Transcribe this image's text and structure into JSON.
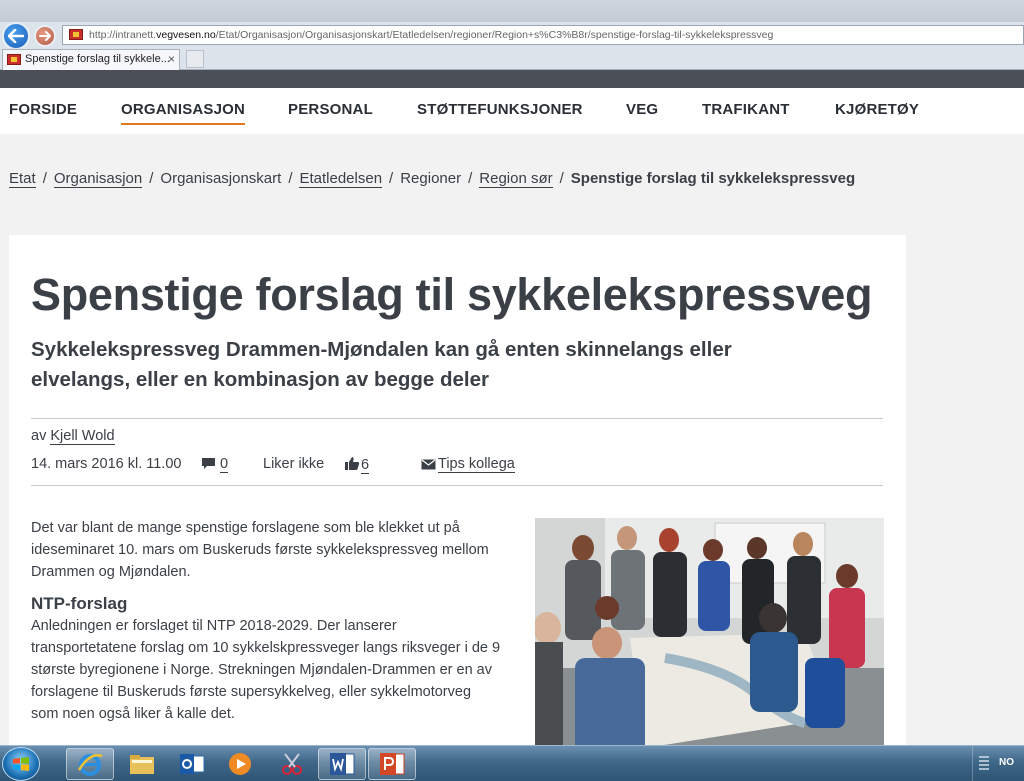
{
  "browser": {
    "url_prefix": "http://intranett.",
    "url_domain": "vegvesen.no",
    "url_path": "/Etat/Organisasjon/Organisasjonskart/Etatledelsen/regioner/Region+s%C3%B8r/spenstige-forslag-til-sykkelekspressveg",
    "tab_title": "Spenstige forslag til sykkele...",
    "tab_close": "×"
  },
  "nav": {
    "items": [
      {
        "label": "FORSIDE",
        "active": false
      },
      {
        "label": "ORGANISASJON",
        "active": true
      },
      {
        "label": "PERSONAL",
        "active": false
      },
      {
        "label": "STØTTEFUNKSJONER",
        "active": false
      },
      {
        "label": "VEG",
        "active": false
      },
      {
        "label": "TRAFIKANT",
        "active": false
      },
      {
        "label": "KJØRETØY",
        "active": false
      }
    ],
    "accent_color": "#e07a1f"
  },
  "breadcrumb": {
    "separator": "/",
    "items": [
      {
        "label": "Etat",
        "link": true
      },
      {
        "label": "Organisasjon",
        "link": true
      },
      {
        "label": "Organisasjonskart",
        "link": false
      },
      {
        "label": "Etatledelsen",
        "link": true
      },
      {
        "label": "Regioner",
        "link": false
      },
      {
        "label": "Region sør",
        "link": true
      },
      {
        "label": "Spenstige forslag til sykkelekspressveg",
        "link": false
      }
    ]
  },
  "article": {
    "title": "Spenstige forslag til sykkelekspressveg",
    "lede": "Sykkelekspressveg Drammen-Mjøndalen kan gå enten skinnelangs eller elvelangs, eller en kombinasjon av begge deler",
    "author_prefix": "av",
    "author": "Kjell Wold",
    "date": "14. mars 2016 kl. 11.00",
    "comment_count": "0",
    "unlike_label": "Liker ikke",
    "like_count": "6",
    "share_label": "Tips kollega",
    "intro": "Det var blant de mange spenstige forslagene som ble klekket ut på ideseminaret 10. mars om Buskeruds første sykkelekspressveg mellom Drammen og Mjøndalen.",
    "section_heading": "NTP-forslag",
    "section_text": "Anledningen er forslaget til NTP 2018-2029. Der lanserer transportetatene forslag om 10 sykkelskpressveger langs riksveger i de 9 største byregionene i Norge. Strekningen Mjøndalen-Drammen er en av forslagene til Buskeruds første supersykkelveg, eller sykkelmotorveg som noen også liker å kalle det."
  },
  "taskbar": {
    "apps": [
      "windows-start",
      "internet-explorer",
      "file-explorer",
      "outlook",
      "media-player",
      "snipping-tool",
      "word",
      "powerpoint"
    ],
    "language": "NO"
  },
  "colors": {
    "text": "#3b4047",
    "background": "#f2f2f2",
    "card": "#ffffff"
  }
}
